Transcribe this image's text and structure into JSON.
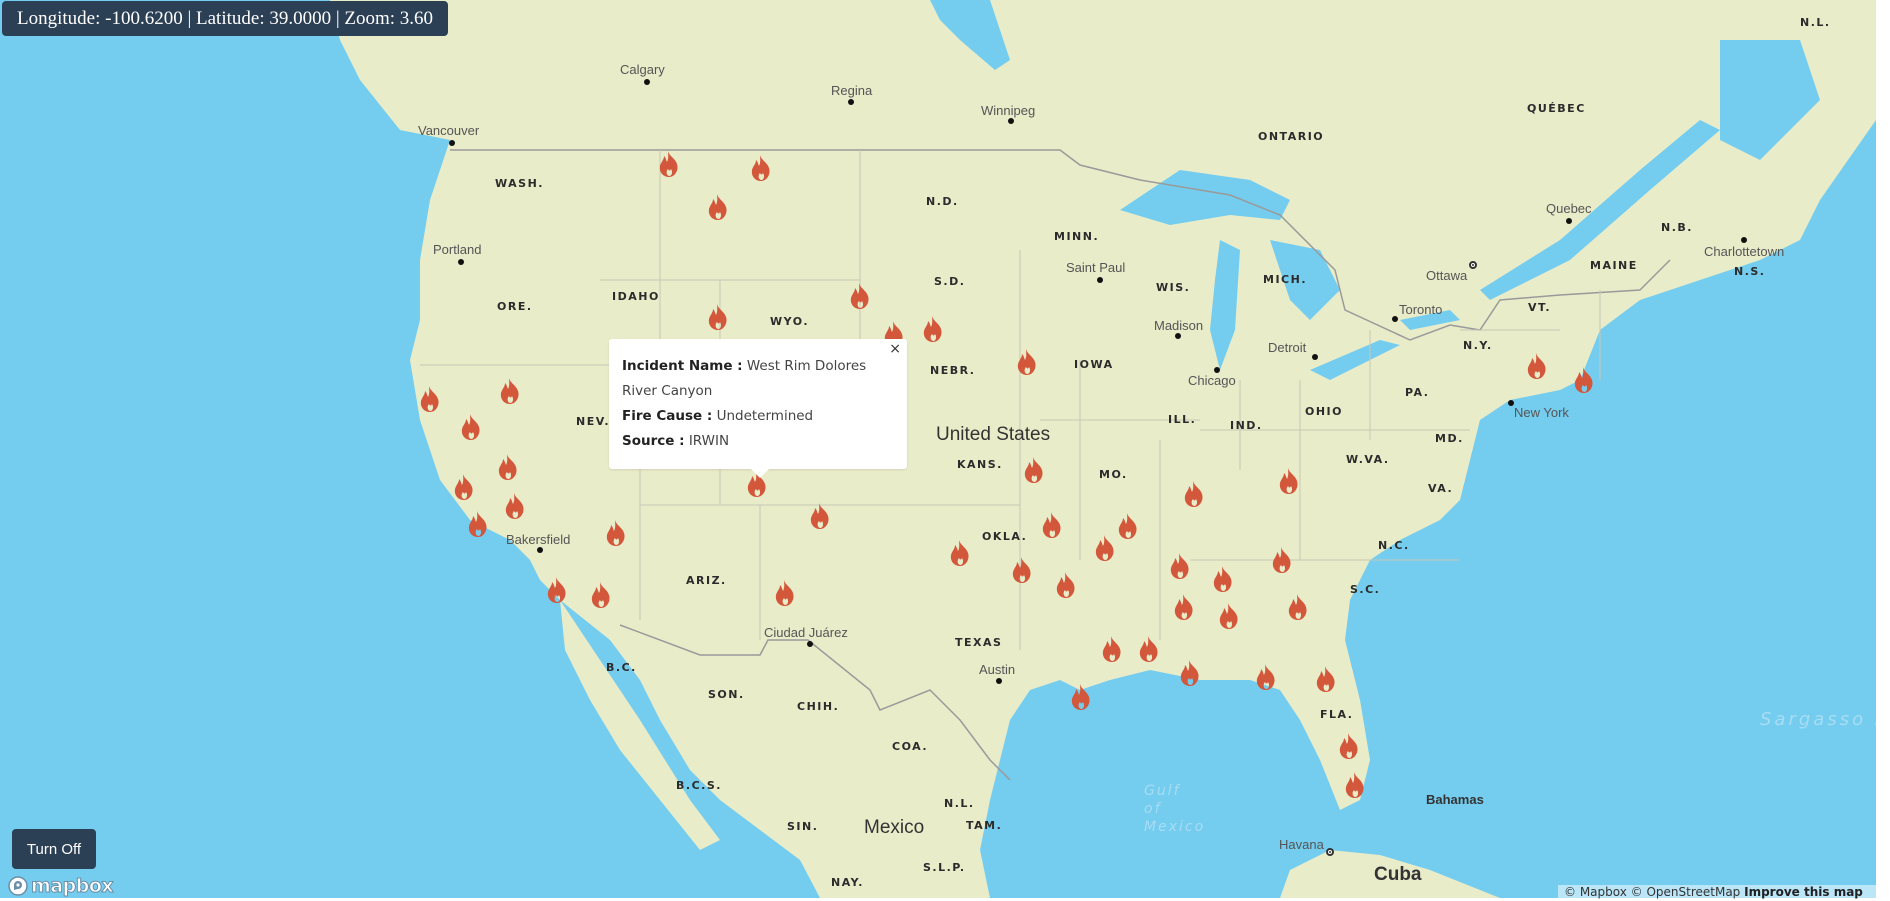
{
  "status_bar": {
    "longitude_label": "Longitude:",
    "longitude": "-100.6200",
    "latitude_label": "Latitude:",
    "latitude": "39.0000",
    "zoom_label": "Zoom:",
    "zoom": "3.60",
    "text": "Longitude: -100.6200 | Latitude: 39.0000 | Zoom: 3.60"
  },
  "popup": {
    "close_icon": "×",
    "fields": [
      {
        "label": "Incident Name :",
        "value": " West Rim Dolores River Canyon"
      },
      {
        "label": "Fire Cause :",
        "value": " Undetermined"
      },
      {
        "label": "Source :",
        "value": " IRWIN"
      }
    ]
  },
  "toggle_button": {
    "label": "Turn Off"
  },
  "logo": {
    "text": "mapbox"
  },
  "attribution": {
    "text": "© Mapbox © OpenStreetMap",
    "improve_link": "Improve this map"
  },
  "colors": {
    "water": "#74cdef",
    "land": "#e8ecc9",
    "fire": "#d3573b",
    "control_bg": "#2b3f55"
  },
  "map_labels": {
    "countries": [
      "United States",
      "Mexico",
      "Cuba"
    ],
    "states": [
      "WASH.",
      "ORE.",
      "IDAHO",
      "NEV.",
      "WYO.",
      "ARIZ.",
      "N.D.",
      "S.D.",
      "NEBR.",
      "KANS.",
      "OKLA.",
      "TEXAS",
      "MINN.",
      "IOWA",
      "MO.",
      "WIS.",
      "ILL.",
      "IND.",
      "OHIO",
      "MICH.",
      "PA.",
      "N.Y.",
      "VT.",
      "MAINE",
      "MD.",
      "VA.",
      "W.VA.",
      "N.C.",
      "S.C.",
      "FLA.",
      "ONTARIO",
      "QUÉBEC",
      "N.B.",
      "N.S.",
      "N.L.",
      "B.C.",
      "SON.",
      "CHIH.",
      "COA.",
      "B.C.S.",
      "SIN.",
      "N.L.",
      "TAM.",
      "S.L.P.",
      "NAY."
    ],
    "cities": [
      "Calgary",
      "Regina",
      "Winnipeg",
      "Vancouver",
      "Portland",
      "Bakersfield",
      "Saint Paul",
      "Madison",
      "Chicago",
      "Detroit",
      "Toronto",
      "Ottawa",
      "Quebec",
      "Charlottetown",
      "New York",
      "Ciudad Juárez",
      "Austin",
      "Havana",
      "Bahamas"
    ],
    "water": [
      "Sargasso Sea",
      "Gulf of Mexico"
    ]
  },
  "fire_markers_count": 49
}
